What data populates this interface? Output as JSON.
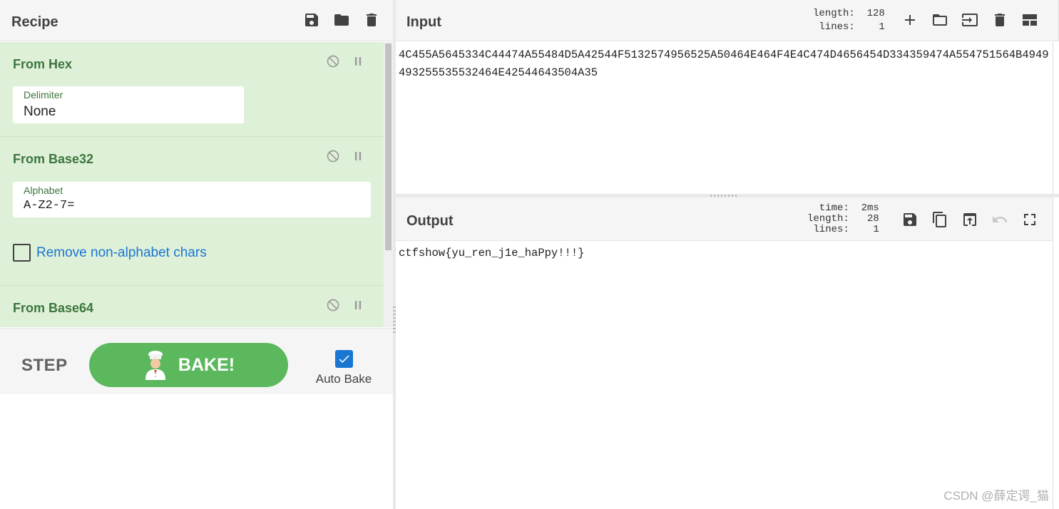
{
  "recipe": {
    "title": "Recipe",
    "header_icons": [
      "save-icon",
      "folder-icon",
      "trash-icon"
    ],
    "operations": [
      {
        "title": "From Hex",
        "arg_label": "Delimiter",
        "arg_value": "None"
      },
      {
        "title": "From Base32",
        "arg_label": "Alphabet",
        "arg_value": "A-Z2-7=",
        "checkbox_label": "Remove non-alphabet chars",
        "checkbox_checked": false
      },
      {
        "title": "From Base64"
      }
    ]
  },
  "controls": {
    "step_label": "STEP",
    "bake_label": "BAKE!",
    "auto_bake_label": "Auto Bake",
    "auto_bake_checked": true
  },
  "input": {
    "title": "Input",
    "stats": {
      "length_key": "length:",
      "length_val": "128",
      "lines_key": "lines:",
      "lines_val": "1"
    },
    "text": "4C455A5645334C44474A55484D5A42544F5132574956525A50464E464F4E4C474D4656454D334359474A554751564B4949493255535532464E42544643504A35"
  },
  "output": {
    "title": "Output",
    "stats": {
      "time_key": "time:",
      "time_val": "2ms",
      "length_key": "length:",
      "length_val": "28",
      "lines_key": "lines:",
      "lines_val": "1"
    },
    "text": "ctfshow{yu_ren_j1e_haPpy!!!}"
  },
  "watermark": "CSDN @薛定谔_猫",
  "colors": {
    "accent_green": "#5cb85c",
    "op_background": "#dff0d8",
    "op_title": "#3c763d",
    "link_blue": "#1976d2"
  }
}
